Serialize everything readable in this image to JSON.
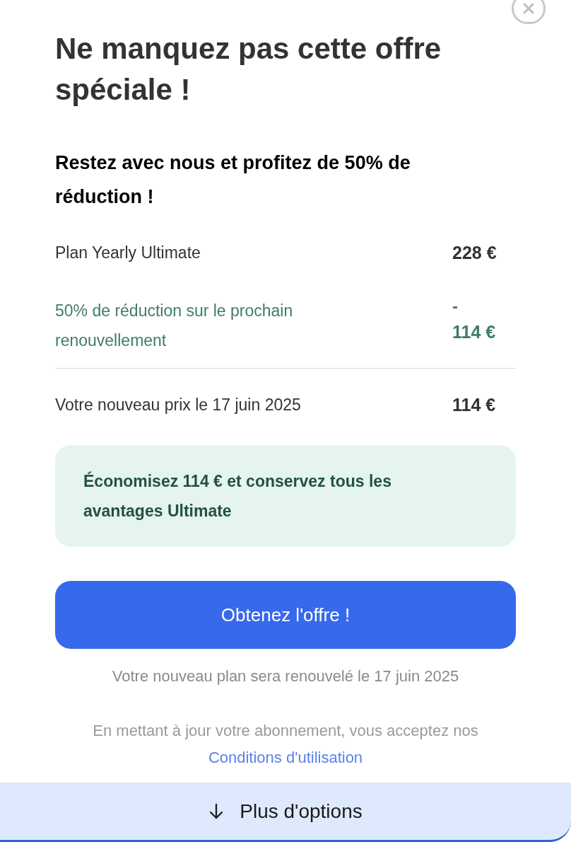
{
  "title": "Ne manquez pas cette offre spéciale !",
  "subtitle": "Restez avec nous et profitez de 50% de réduction !",
  "lines": [
    {
      "kind": "plain",
      "label": "Plan Yearly Ultimate",
      "amount": "228 €"
    },
    {
      "kind": "discount",
      "label": "50% de réduction sur le prochain renouvellement",
      "sign": "-",
      "amount": "114 €"
    },
    {
      "kind": "total",
      "label": "Votre nouveau prix le 17 juin 2025",
      "amount": "114 €"
    }
  ],
  "savings": "Économisez 114 € et conservez tous les avantages Ultimate",
  "cta": "Obtenez l'offre !",
  "renewal_note": "Votre nouveau plan sera renouvelé le 17 juin 2025",
  "legal": {
    "text": "En mettant à jour votre abonnement, vous acceptez nos",
    "link": "Conditions d'utilisation"
  },
  "more_options": "Plus d'options"
}
